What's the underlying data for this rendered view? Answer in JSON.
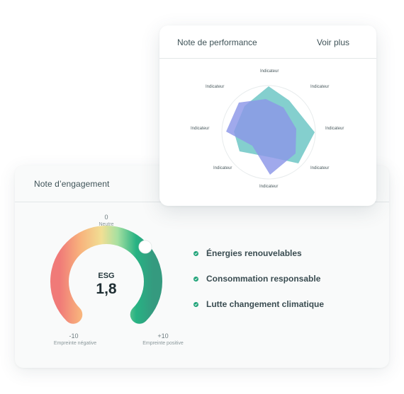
{
  "performance": {
    "title": "Note de performance",
    "link_label": "Voir plus",
    "radar_labels": [
      "Indicateur",
      "Indicateur",
      "Indicateur",
      "Indicateur",
      "Indicateur",
      "Indicateur",
      "Indicateur",
      "Indicateur"
    ],
    "colors": {
      "series_a": "#6fc7c6",
      "series_b": "#8b96e8"
    }
  },
  "engagement": {
    "title": "Note d’engagement",
    "gauge": {
      "label": "ESG",
      "value": "1,8",
      "top_value": "0",
      "top_label": "Neutre",
      "min_value": "-10",
      "min_label": "Empreinte négative",
      "max_value": "+10",
      "max_label": "Empreinte positive",
      "colors": [
        "#f07a78",
        "#f7b37a",
        "#f5dc8e",
        "#a9e0a0",
        "#22ad80",
        "#3e9e86"
      ]
    },
    "criteria": [
      {
        "label": "Énergies renouvelables",
        "icon": "check-icon"
      },
      {
        "label": "Consommation responsable",
        "icon": "check-icon"
      },
      {
        "label": "Lutte changement climatique",
        "icon": "check-icon"
      }
    ]
  }
}
